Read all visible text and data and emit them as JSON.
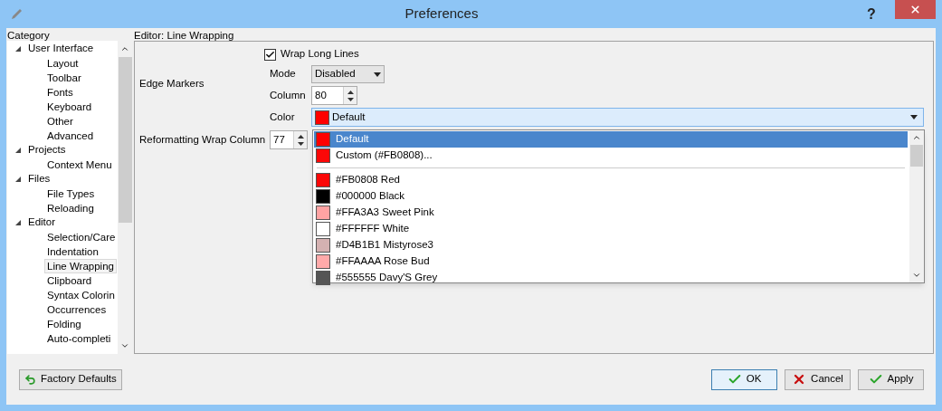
{
  "window": {
    "title": "Preferences",
    "help": "?"
  },
  "category": {
    "label": "Category",
    "items": [
      {
        "label": "User Interface",
        "expanded": true,
        "children": [
          {
            "label": "Layout",
            "selected": false
          },
          {
            "label": "Toolbar",
            "selected": false
          },
          {
            "label": "Fonts",
            "selected": false
          },
          {
            "label": "Keyboard",
            "selected": false
          },
          {
            "label": "Other",
            "selected": false
          },
          {
            "label": "Advanced",
            "selected": false
          }
        ]
      },
      {
        "label": "Projects",
        "expanded": true,
        "children": [
          {
            "label": "Context Menu",
            "selected": false
          }
        ]
      },
      {
        "label": "Files",
        "expanded": true,
        "children": [
          {
            "label": "File Types",
            "selected": false
          },
          {
            "label": "Reloading",
            "selected": false
          }
        ]
      },
      {
        "label": "Editor",
        "expanded": true,
        "children": [
          {
            "label": "Selection/Care",
            "selected": false
          },
          {
            "label": "Indentation",
            "selected": false
          },
          {
            "label": "Line Wrapping",
            "selected": true
          },
          {
            "label": "Clipboard",
            "selected": false
          },
          {
            "label": "Syntax Colorin",
            "selected": false
          },
          {
            "label": "Occurrences",
            "selected": false
          },
          {
            "label": "Folding",
            "selected": false
          },
          {
            "label": "Auto-completi",
            "selected": false
          }
        ]
      }
    ]
  },
  "panel": {
    "title": "Editor: Line Wrapping",
    "wrap_long_lines": {
      "label": "Wrap Long Lines",
      "checked": true
    },
    "edge_markers": {
      "label": "Edge Markers",
      "mode_label": "Mode",
      "mode": "Disabled",
      "column_label": "Column",
      "column": "80",
      "color_label": "Color",
      "color_value": "Default",
      "swatch": {
        "color": "#ff0000"
      }
    },
    "reformatting": {
      "label": "Reformatting Wrap Column",
      "value": "77"
    }
  },
  "color_menu": {
    "items": [
      {
        "label": "Default",
        "color": "#ff0000",
        "selected": true
      },
      {
        "label": "Custom (#FB0808)...",
        "color": "#fb0808",
        "selected": false
      }
    ],
    "palette": [
      {
        "label": "#FB0808 Red",
        "color": "#fb0808",
        "selected": false
      },
      {
        "label": "#000000 Black",
        "color": "#000000",
        "selected": false
      },
      {
        "label": "#FFA3A3 Sweet Pink",
        "color": "#ffa3a3",
        "selected": false
      },
      {
        "label": "#FFFFFF White",
        "color": "#ffffff",
        "selected": false
      },
      {
        "label": "#D4B1B1 Mistyrose3",
        "color": "#d4b1b1",
        "selected": false
      },
      {
        "label": "#FFAAAA Rose Bud",
        "color": "#ffaaaa",
        "selected": false
      },
      {
        "label": "#555555 Davy'S Grey",
        "color": "#555555",
        "selected": false
      }
    ]
  },
  "buttons": {
    "factory_defaults": "Factory Defaults",
    "ok": "OK",
    "cancel": "Cancel",
    "apply": "Apply"
  }
}
